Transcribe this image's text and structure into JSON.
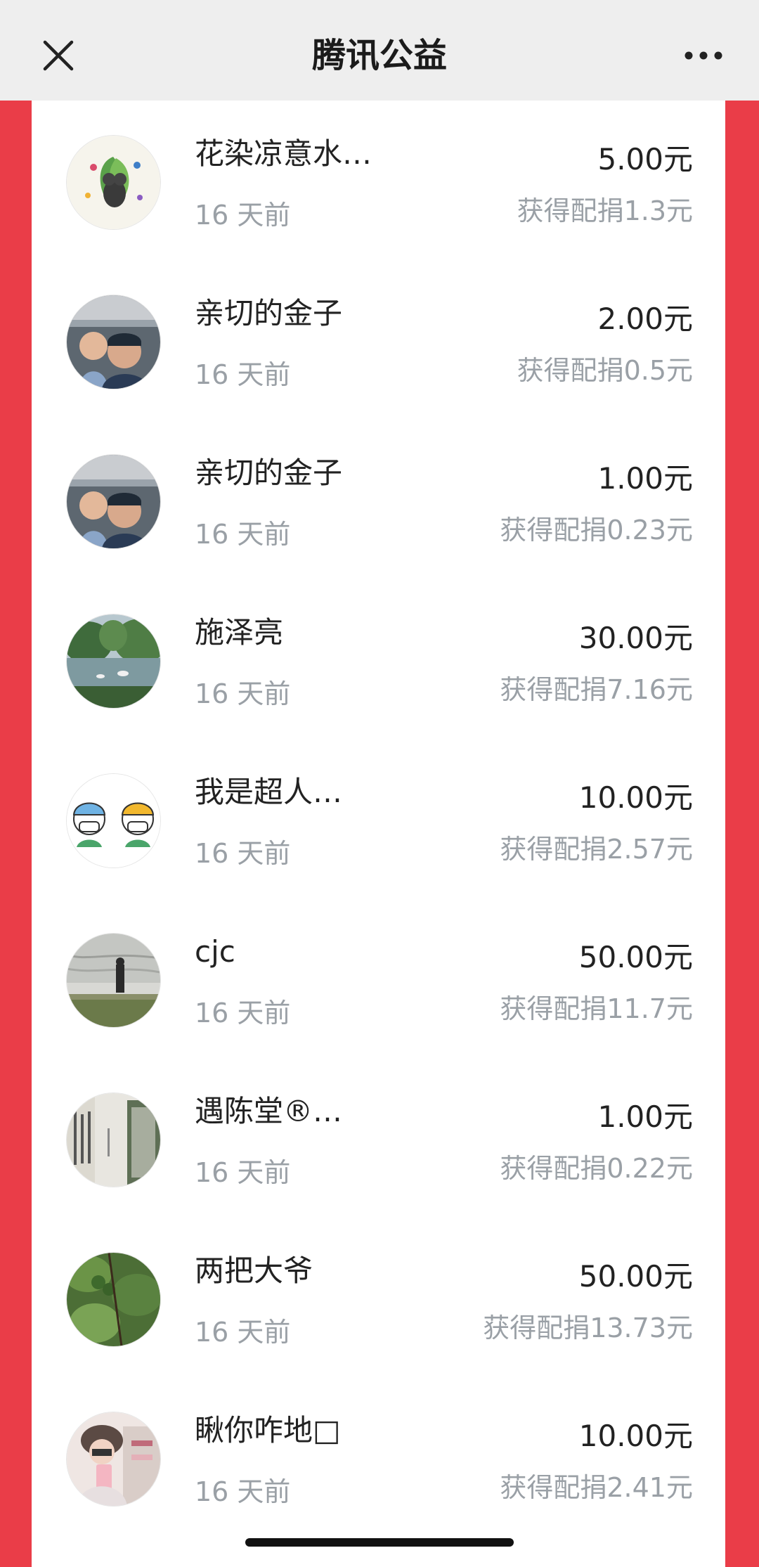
{
  "nav": {
    "title": "腾讯公益",
    "close_icon": "close-icon",
    "more_icon": "more-icon"
  },
  "colors": {
    "side_accent": "#ea3d48",
    "nav_bg": "#eeeeee",
    "primary_text": "#222222",
    "secondary_text": "#9aa0a6"
  },
  "donations": [
    {
      "name": "花染凉意水…",
      "time": "16 天前",
      "amount": "5.00元",
      "match": "获得配捐1.3元"
    },
    {
      "name": "亲切的金子",
      "time": "16 天前",
      "amount": "2.00元",
      "match": "获得配捐0.5元"
    },
    {
      "name": "亲切的金子",
      "time": "16 天前",
      "amount": "1.00元",
      "match": "获得配捐0.23元"
    },
    {
      "name": "施泽亮",
      "time": "16 天前",
      "amount": "30.00元",
      "match": "获得配捐7.16元"
    },
    {
      "name": "我是超人…",
      "time": "16 天前",
      "amount": "10.00元",
      "match": "获得配捐2.57元"
    },
    {
      "name": "cjc",
      "time": "16 天前",
      "amount": "50.00元",
      "match": "获得配捐11.7元"
    },
    {
      "name": "遇陈堂®…",
      "time": "16 天前",
      "amount": "1.00元",
      "match": "获得配捐0.22元"
    },
    {
      "name": "两把大爷",
      "time": "16 天前",
      "amount": "50.00元",
      "match": "获得配捐13.73元"
    },
    {
      "name": "瞅你咋地□",
      "time": "16 天前",
      "amount": "10.00元",
      "match": "获得配捐2.41元"
    }
  ]
}
